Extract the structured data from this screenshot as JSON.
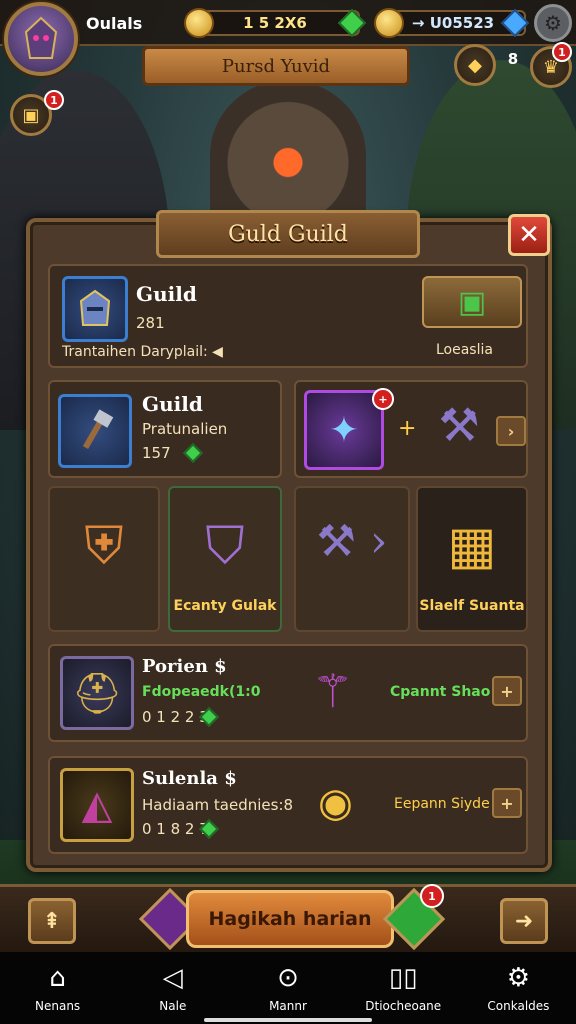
{
  "header": {
    "player_name": "Oulals",
    "gold": "1 5 2X6",
    "gems": "→ U05523",
    "banner": "Pursd Yuvid",
    "badge_guild": "1",
    "notif_count": "8",
    "badge_chest": "1"
  },
  "panel": {
    "title": "Guld Guild",
    "close": "✕",
    "guild_card": {
      "name": "Guild",
      "level": "281",
      "desc": "Trantaihen Daryplail: ◀",
      "reward_label": "Loeaslia"
    },
    "item_card": {
      "name": "Guild",
      "sub": "Pratunalien",
      "value": "157",
      "plus": "+"
    },
    "tiles": [
      {
        "label": ""
      },
      {
        "label": "Ecanty Gulak"
      },
      {
        "label": ""
      },
      {
        "label": "Slaelf Suanta"
      }
    ],
    "rows": [
      {
        "title": "Porien $",
        "sub": "Fdopeaedk(1:0",
        "value": "0 1 2 2 3",
        "right_label": "Cpannt Shao"
      },
      {
        "title": "Sulenla $",
        "sub": "Hadiaam taednies:8",
        "value": "0 1 8 2 7",
        "right_label": "Eepann Siyde"
      }
    ]
  },
  "bottom": {
    "main_action": "Hagikah harian",
    "badge": "1"
  },
  "nav": [
    {
      "icon": "home-icon",
      "label": "Nenans"
    },
    {
      "icon": "back-icon",
      "label": "Nale"
    },
    {
      "icon": "circle-icon",
      "label": "Mannr"
    },
    {
      "icon": "recents-icon",
      "label": "Dtiocheoane"
    },
    {
      "icon": "gear-icon",
      "label": "Conkaldes"
    }
  ],
  "colors": {
    "panel": "#4d3a2a",
    "frame": "#7b5a36",
    "gold_text": "#ffcf4a",
    "green_text": "#66e05a",
    "badge_red": "#d21f1f"
  }
}
